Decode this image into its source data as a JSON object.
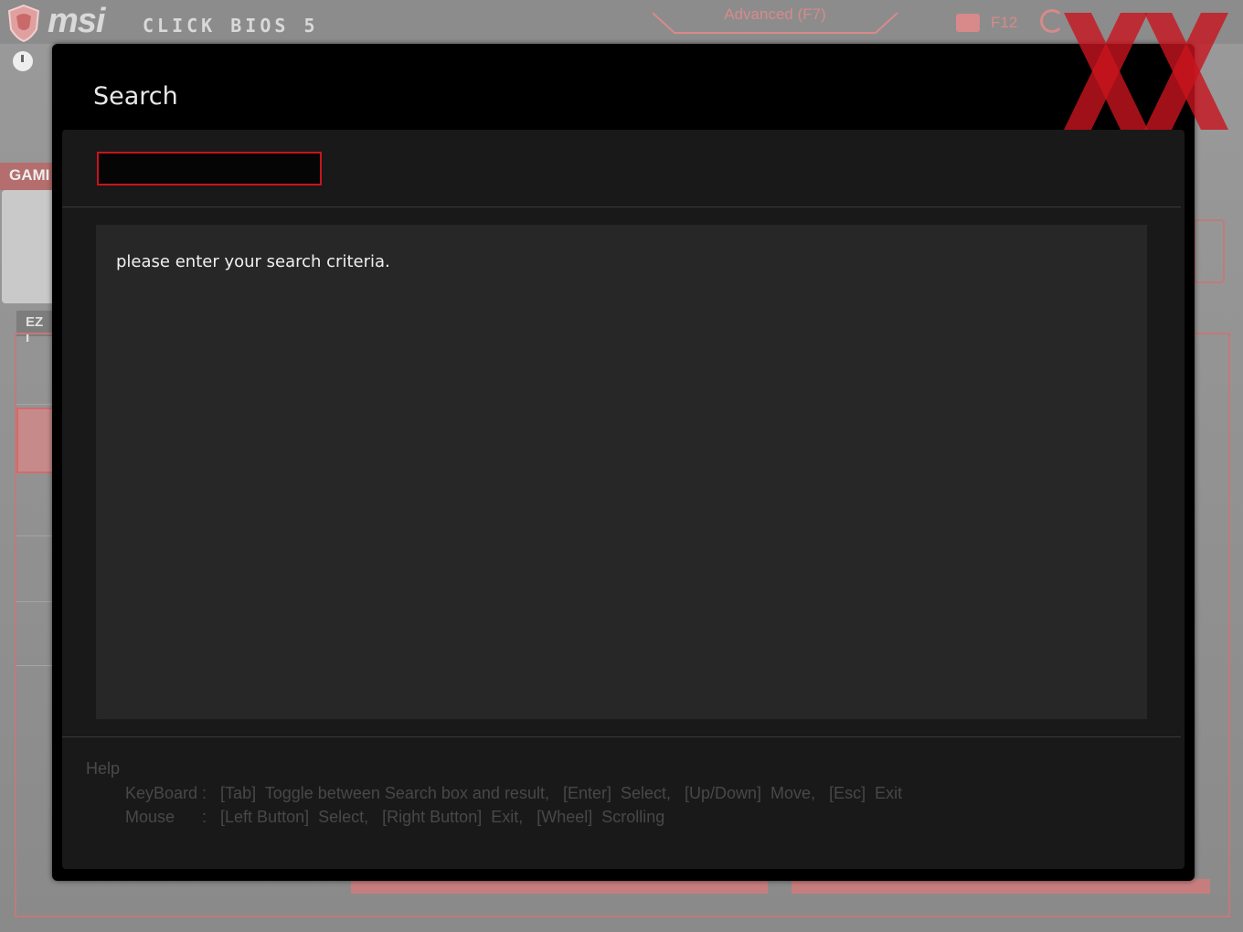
{
  "header": {
    "brand": "msi",
    "product": "CLICK BIOS 5",
    "mode_tab": "Advanced (F7)",
    "screenshot_key": "F12"
  },
  "background": {
    "game_tab": "GAMI",
    "ez_label": "EZ I"
  },
  "dialog": {
    "title": "Search",
    "search": {
      "value": "",
      "placeholder": ""
    },
    "results_message": "please enter your search criteria.",
    "help": {
      "title": "Help",
      "keyboard": "KeyBoard :   [Tab]  Toggle between Search box and result,   [Enter]  Select,   [Up/Down]  Move,   [Esc]  Exit",
      "mouse": "Mouse      :   [Left Button]  Select,   [Right Button]  Exit,   [Wheel]  Scrolling"
    }
  },
  "colors": {
    "accent": "#c8141e",
    "dialog_bg": "#000000",
    "panel_bg": "#191919",
    "results_bg": "#272727",
    "help_text": "#484848"
  },
  "icons": [
    "msi-dragon-shield-icon",
    "camera-icon",
    "refresh-icon",
    "clock-icon",
    "watermark-xx-icon"
  ]
}
